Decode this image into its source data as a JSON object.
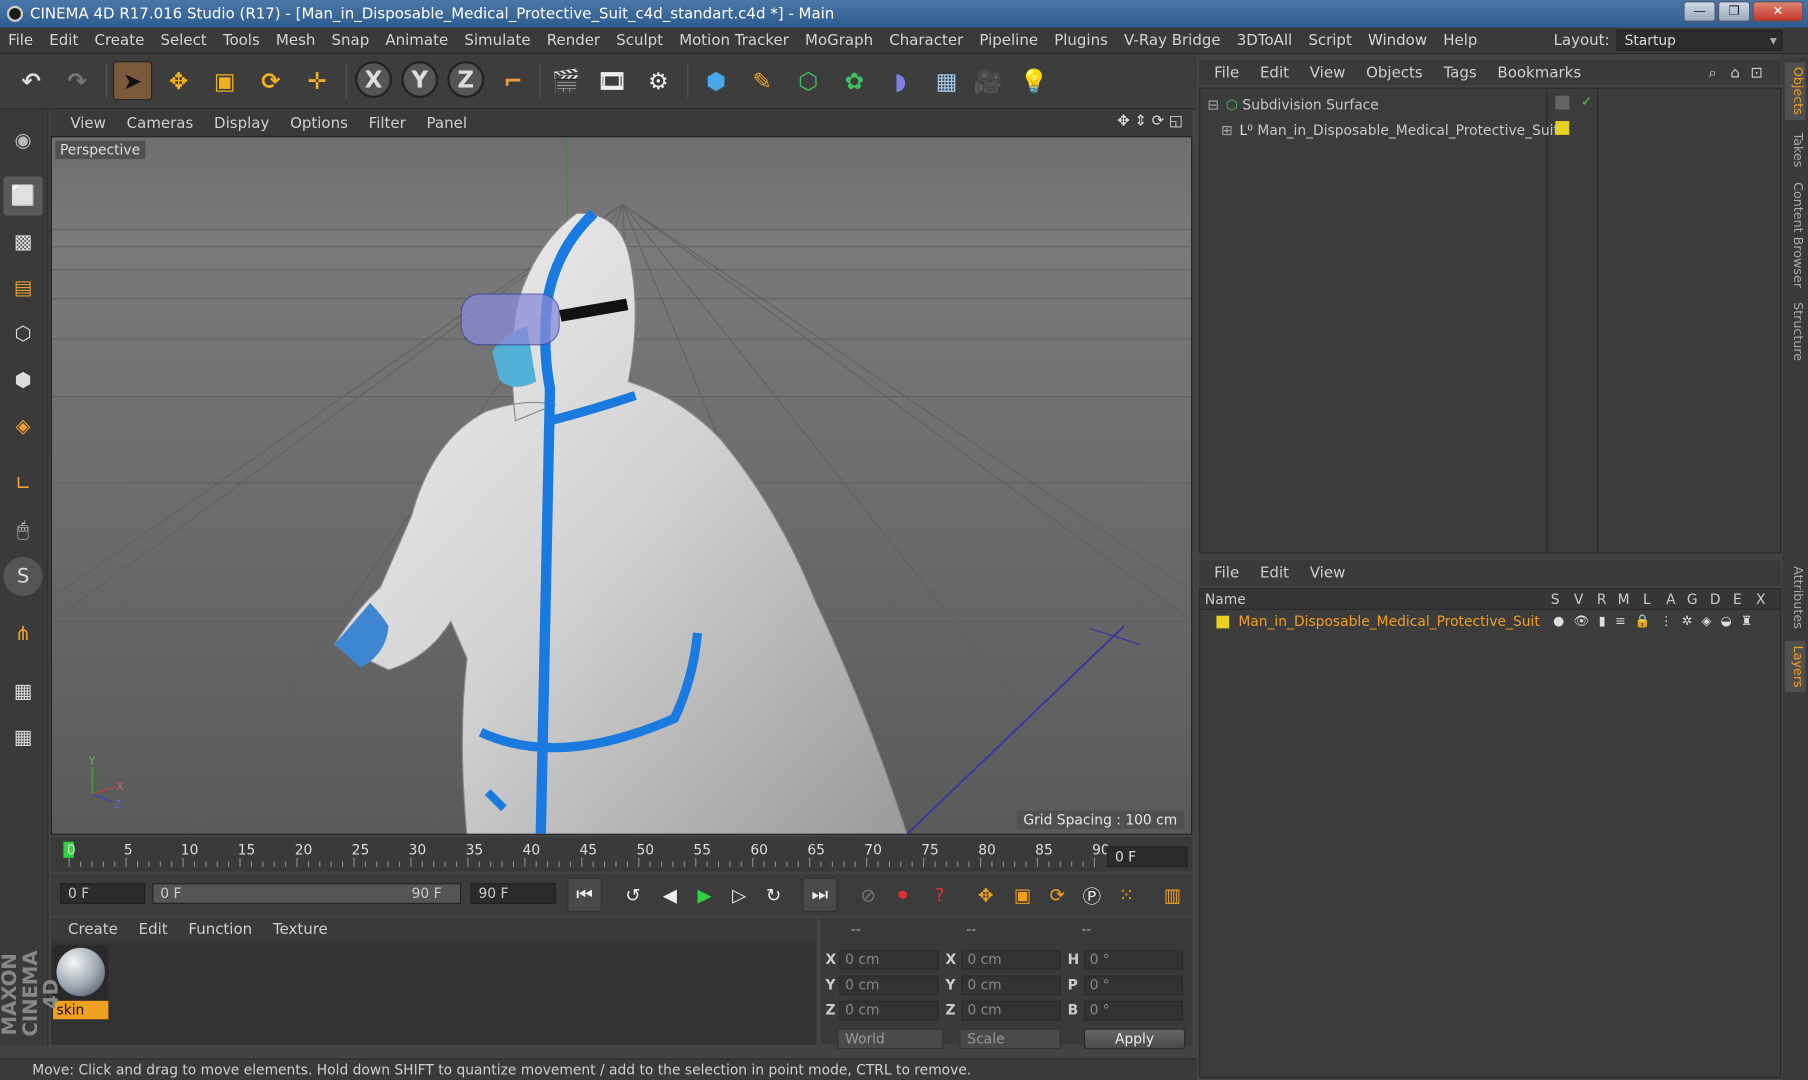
{
  "window": {
    "title": "CINEMA 4D R17.016 Studio (R17) - [Man_in_Disposable_Medical_Protective_Suit_c4d_standart.c4d *] - Main"
  },
  "menubar": {
    "items": [
      "File",
      "Edit",
      "Create",
      "Select",
      "Tools",
      "Mesh",
      "Snap",
      "Animate",
      "Simulate",
      "Render",
      "Sculpt",
      "Motion Tracker",
      "MoGraph",
      "Character",
      "Pipeline",
      "Plugins",
      "V-Ray Bridge",
      "3DToAll",
      "Script",
      "Window",
      "Help"
    ],
    "layout_label": "Layout:",
    "layout_value": "Startup"
  },
  "toolbar": {
    "axis_x": "X",
    "axis_y": "Y",
    "axis_z": "Z"
  },
  "viewport": {
    "menu": [
      "View",
      "Cameras",
      "Display",
      "Options",
      "Filter",
      "Panel"
    ],
    "label": "Perspective",
    "grid_spacing": "Grid Spacing : 100 cm",
    "axis_labels": {
      "y": "Y",
      "x": "X",
      "z": "Z"
    }
  },
  "timeline": {
    "ticks": [
      "0",
      "5",
      "10",
      "15",
      "20",
      "25",
      "30",
      "35",
      "40",
      "45",
      "50",
      "55",
      "60",
      "65",
      "70",
      "75",
      "80",
      "85",
      "90"
    ],
    "current_frame": "0 F"
  },
  "playback": {
    "start": "0 F",
    "range_start": "0 F",
    "range_end": "90 F",
    "end": "90 F"
  },
  "materials": {
    "menu": [
      "Create",
      "Edit",
      "Function",
      "Texture"
    ],
    "items": [
      {
        "name": "skin"
      }
    ]
  },
  "coordinates": {
    "header": [
      "--",
      "--",
      "--"
    ],
    "rows": [
      {
        "a": "X",
        "av": "0 cm",
        "b": "X",
        "bv": "0 cm",
        "c": "H",
        "cv": "0 °"
      },
      {
        "a": "Y",
        "av": "0 cm",
        "b": "Y",
        "bv": "0 cm",
        "c": "P",
        "cv": "0 °"
      },
      {
        "a": "Z",
        "av": "0 cm",
        "b": "Z",
        "bv": "0 cm",
        "c": "B",
        "cv": "0 °"
      }
    ],
    "mode1": "World",
    "mode2": "Scale",
    "apply": "Apply"
  },
  "status": {
    "text": "Move: Click and drag to move elements. Hold down SHIFT to quantize movement / add to the selection in point mode, CTRL to remove."
  },
  "branding": {
    "logo": "MAXON CINEMA 4D"
  },
  "objects": {
    "menu": [
      "File",
      "Edit",
      "View",
      "Objects",
      "Tags",
      "Bookmarks"
    ],
    "items": [
      {
        "name": "Subdivision Surface"
      },
      {
        "name": "Man_in_Disposable_Medical_Protective_Suit"
      }
    ]
  },
  "layers": {
    "menu": [
      "File",
      "Edit",
      "View"
    ],
    "columns": [
      "Name",
      "S",
      "V",
      "R",
      "M",
      "L",
      "A",
      "G",
      "D",
      "E",
      "X"
    ],
    "items": [
      {
        "name": "Man_in_Disposable_Medical_Protective_Suit"
      }
    ]
  },
  "side_tabs": [
    "Objects",
    "Takes",
    "Content Browser",
    "Structure",
    "Attributes",
    "Layers"
  ]
}
